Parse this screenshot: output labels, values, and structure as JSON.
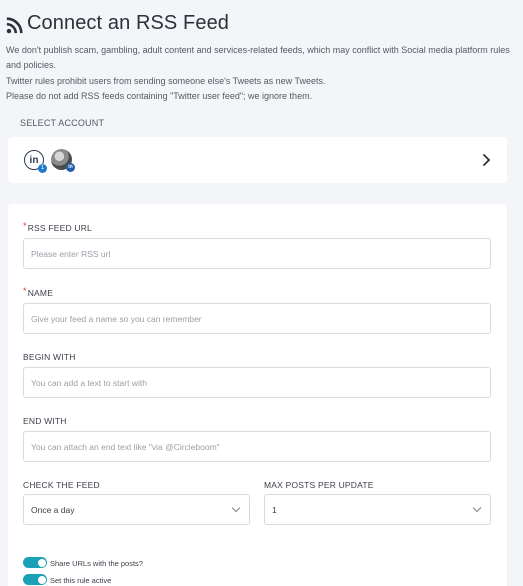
{
  "header": {
    "title": "Connect an RSS Feed",
    "icon": "rss-icon",
    "notice_lines": [
      "We don't publish scam, gambling, adult content and services-related feeds, which may conflict with Social media platform rules",
      "and policies.",
      "Twitter rules prohibit users from sending someone else's Tweets as new Tweets.",
      "Please do not add RSS feeds containing \"Twitter user feed\"; we ignore them."
    ]
  },
  "account": {
    "label": "SELECT ACCOUNT",
    "linkedin_text": "in",
    "linkedin_badge": "1",
    "avatar_badge": "in"
  },
  "form": {
    "required_mark": "*",
    "rss_url": {
      "label": "RSS FEED URL",
      "placeholder": "Please enter RSS url",
      "value": ""
    },
    "name": {
      "label": "NAME",
      "placeholder": "Give your feed a name so you can remember",
      "value": ""
    },
    "begin_with": {
      "label": "BEGIN WITH",
      "placeholder": "You can add a text to start with",
      "value": ""
    },
    "end_with": {
      "label": "END WITH",
      "placeholder": "You can attach an end text like \"via @Circleboom\"",
      "value": ""
    },
    "check_feed": {
      "label": "CHECK THE FEED",
      "value": "Once a day"
    },
    "max_posts": {
      "label": "MAX POSTS PER UPDATE",
      "value": "1"
    },
    "toggles": [
      {
        "label": "Share URLs with the posts?",
        "on": true
      },
      {
        "label": "Set this rule active",
        "on": true
      }
    ]
  },
  "colors": {
    "accent": "#1aa1b6",
    "required": "#e03b3b",
    "background": "#f3f5f8"
  }
}
